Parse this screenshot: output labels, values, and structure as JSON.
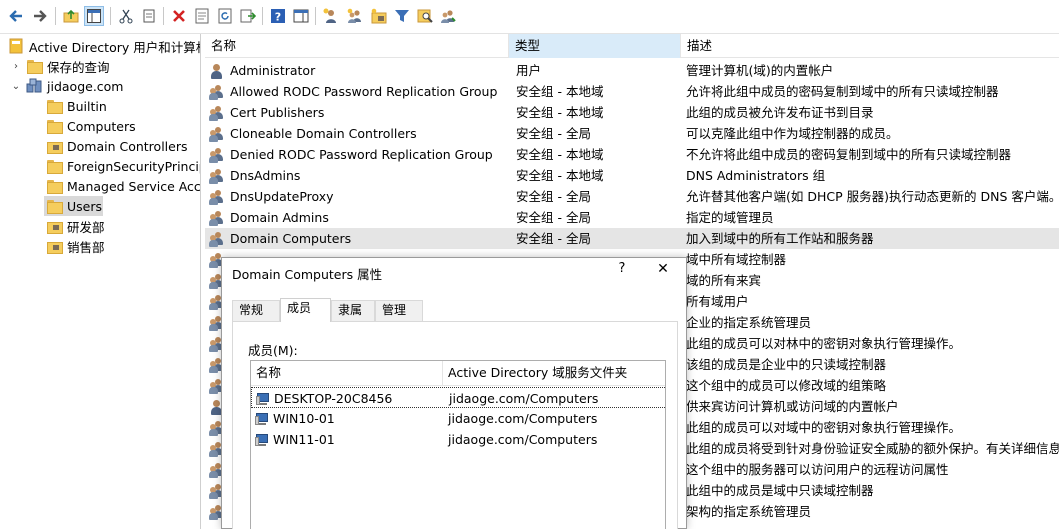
{
  "toolbar": {
    "icons": [
      "back-arrow-icon",
      "forward-arrow-icon",
      "up-folder-icon",
      "show-hide-console-tree-icon",
      "cut-icon",
      "copy-icon",
      "delete-icon",
      "properties-icon",
      "refresh-icon",
      "export-list-icon",
      "help-icon",
      "show-action-pane-icon",
      "create-user-icon",
      "create-group-icon",
      "create-ou-icon",
      "filter-icon",
      "find-icon",
      "add-to-group-icon"
    ]
  },
  "tree": {
    "root": "Active Directory 用户和计算机",
    "saved_queries": "保存的查询",
    "domain": "jidaoge.com",
    "children": [
      "Builtin",
      "Computers",
      "Domain Controllers",
      "ForeignSecurityPrincipals",
      "Managed Service Accounts",
      "Users",
      "研发部",
      "销售部"
    ],
    "selected": "Users"
  },
  "list": {
    "columns": [
      "名称",
      "类型",
      "描述"
    ],
    "rows": [
      {
        "name": "Administrator",
        "type": "用户",
        "desc": "管理计算机(域)的内置帐户",
        "kind": "user"
      },
      {
        "name": "Allowed RODC Password Replication Group",
        "type": "安全组 - 本地域",
        "desc": "允许将此组中成员的密码复制到域中的所有只读域控制器",
        "kind": "group"
      },
      {
        "name": "Cert Publishers",
        "type": "安全组 - 本地域",
        "desc": "此组的成员被允许发布证书到目录",
        "kind": "group"
      },
      {
        "name": "Cloneable Domain Controllers",
        "type": "安全组 - 全局",
        "desc": "可以克隆此组中作为域控制器的成员。",
        "kind": "group"
      },
      {
        "name": "Denied RODC Password Replication Group",
        "type": "安全组 - 本地域",
        "desc": "不允许将此组中成员的密码复制到域中的所有只读域控制器",
        "kind": "group"
      },
      {
        "name": "DnsAdmins",
        "type": "安全组 - 本地域",
        "desc": "DNS Administrators 组",
        "kind": "group"
      },
      {
        "name": "DnsUpdateProxy",
        "type": "安全组 - 全局",
        "desc": "允许替其他客户端(如 DHCP 服务器)执行动态更新的 DNS 客户端。",
        "kind": "group"
      },
      {
        "name": "Domain Admins",
        "type": "安全组 - 全局",
        "desc": "指定的域管理员",
        "kind": "group"
      },
      {
        "name": "Domain Computers",
        "type": "安全组 - 全局",
        "desc": "加入到域中的所有工作站和服务器",
        "kind": "group"
      },
      {
        "name": "",
        "type": "",
        "desc": "域中所有域控制器",
        "kind": "group"
      },
      {
        "name": "",
        "type": "",
        "desc": "域的所有来宾",
        "kind": "group"
      },
      {
        "name": "",
        "type": "",
        "desc": "所有域用户",
        "kind": "group"
      },
      {
        "name": "",
        "type": "",
        "desc": "企业的指定系统管理员",
        "kind": "group"
      },
      {
        "name": "",
        "type": "",
        "desc": "此组的成员可以对林中的密钥对象执行管理操作。",
        "kind": "group"
      },
      {
        "name": "",
        "type": "",
        "desc": "该组的成员是企业中的只读域控制器",
        "kind": "group"
      },
      {
        "name": "",
        "type": "",
        "desc": "这个组中的成员可以修改域的组策略",
        "kind": "group"
      },
      {
        "name": "",
        "type": "",
        "desc": "供来宾访问计算机或访问域的内置帐户",
        "kind": "user"
      },
      {
        "name": "",
        "type": "",
        "desc": "此组的成员可以对域中的密钥对象执行管理操作。",
        "kind": "group"
      },
      {
        "name": "",
        "type": "",
        "desc": "此组的成员将受到针对身份验证安全威胁的额外保护。有关详细信息，",
        "kind": "group"
      },
      {
        "name": "",
        "type": "",
        "desc": "这个组中的服务器可以访问用户的远程访问属性",
        "kind": "group"
      },
      {
        "name": "",
        "type": "",
        "desc": "此组中的成员是域中只读域控制器",
        "kind": "group"
      },
      {
        "name": "",
        "type": "",
        "desc": "架构的指定系统管理员",
        "kind": "group"
      }
    ]
  },
  "dialog": {
    "title": "Domain Computers 属性",
    "help": "?",
    "close": "✕",
    "tabs": [
      "常规",
      "成员",
      "隶属于",
      "管理者"
    ],
    "active_tab": "成员",
    "members_label": "成员(M):",
    "member_columns": [
      "名称",
      "Active Directory 域服务文件夹"
    ],
    "members": [
      {
        "name": "DESKTOP-20C8456",
        "folder": "jidaoge.com/Computers"
      },
      {
        "name": "WIN10-01",
        "folder": "jidaoge.com/Computers"
      },
      {
        "name": "WIN11-01",
        "folder": "jidaoge.com/Computers"
      }
    ]
  },
  "colors": {
    "sorted_header": "#d9ebf9",
    "selected_tree": "#d9d9d9",
    "highlight_row": "#e5e5e5",
    "folder": "#f5cd5d"
  }
}
